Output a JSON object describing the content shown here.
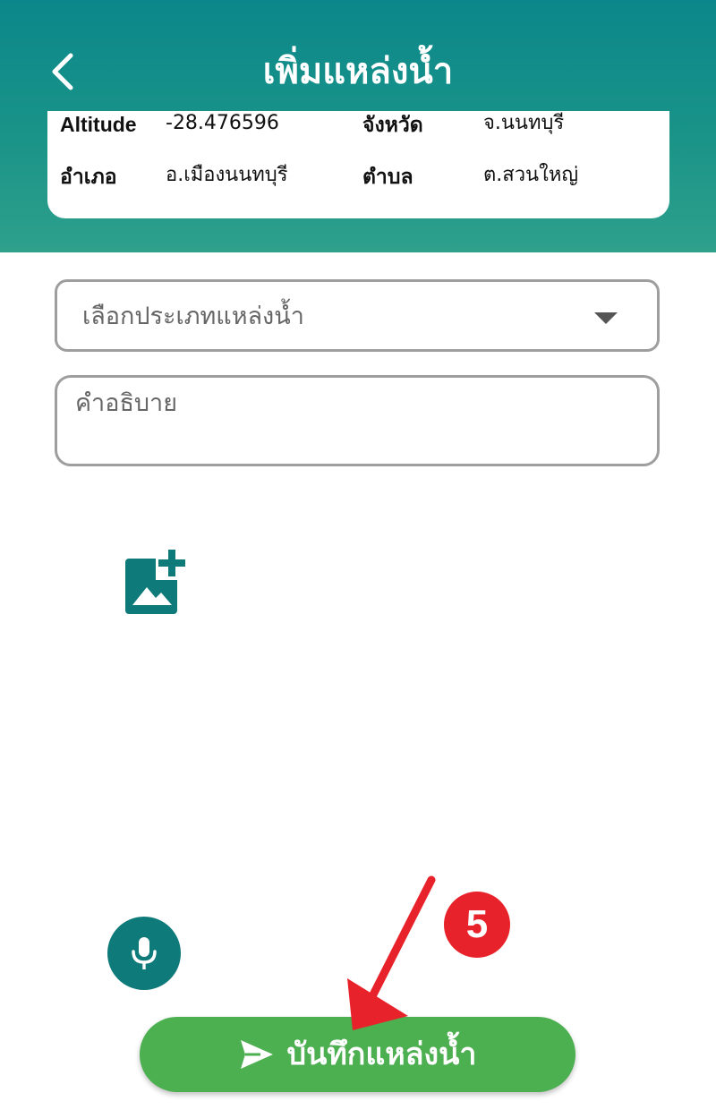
{
  "header": {
    "title": "เพิ่มแหล่งน้ำ",
    "color": "#0b878b"
  },
  "info": {
    "altitude_label": "Altitude",
    "altitude_value": "-28.476596",
    "province_label": "จังหวัด",
    "province_value": "จ.นนทบุรี",
    "district_label": "อำเภอ",
    "district_value": "อ.เมืองนนทบุรี",
    "subdistrict_label": "ตำบล",
    "subdistrict_value": "ต.สวนใหญ่"
  },
  "form": {
    "type_select_placeholder": "เลือกประเภทแหล่งน้ำ",
    "description_placeholder": "คำอธิบาย"
  },
  "icons": {
    "back": "back-arrow-icon",
    "add_photo": "add-photo-icon",
    "mic": "microphone-icon",
    "send": "send-icon",
    "dropdown": "caret-down-icon"
  },
  "save_button": {
    "label": "บันทึกแหล่งน้ำ",
    "color": "#4caf50"
  },
  "annotation": {
    "step": "5",
    "color": "#e8222a"
  }
}
